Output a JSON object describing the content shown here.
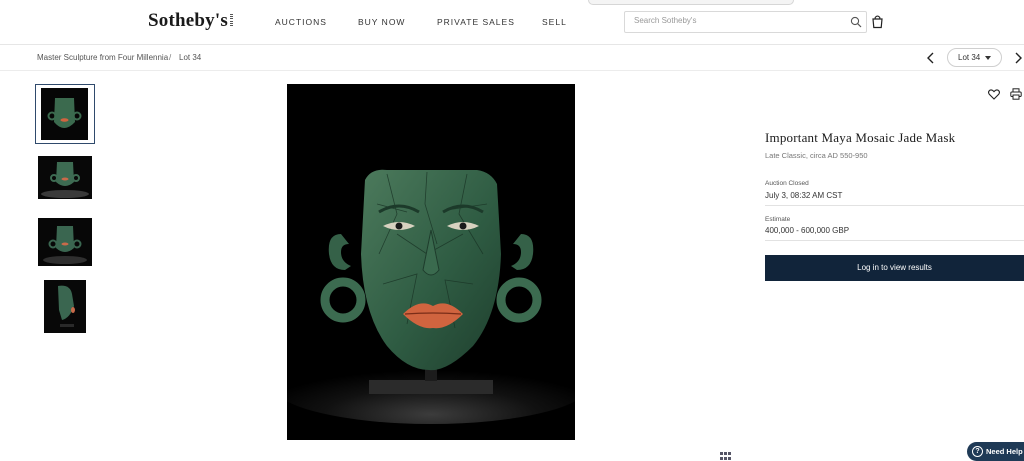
{
  "header": {
    "logo": "Sotheby's",
    "logo_est": "EST 1744",
    "nav": [
      "AUCTIONS",
      "BUY NOW",
      "PRIVATE SALES",
      "SELL"
    ],
    "search_placeholder": "Search Sotheby's"
  },
  "breadcrumb": {
    "parent": "Master Sculpture from Four Millennia",
    "separator": "/",
    "current": "Lot 34"
  },
  "lot_nav": {
    "selected": "Lot 34"
  },
  "lot": {
    "title": "Important Maya Mosaic Jade Mask",
    "subtitle": "Late Classic, circa AD 550-950",
    "status_label": "Auction Closed",
    "status_value": "July 3, 08:32 AM CST",
    "estimate_label": "Estimate",
    "estimate_value": "400,000 - 600,000 GBP",
    "cta": "Log in to view results"
  },
  "help": {
    "label": "Need Help"
  },
  "colors": {
    "accent": "#11243a",
    "thumb_border": "#2f4a6c",
    "jade": "#2d5a42",
    "lips": "#d0643f"
  },
  "icons": [
    "search-icon",
    "shopping-bag-icon",
    "chevron-left-icon",
    "chevron-down-icon",
    "chevron-right-icon",
    "heart-icon",
    "print-icon",
    "grid-icon",
    "question-icon"
  ]
}
